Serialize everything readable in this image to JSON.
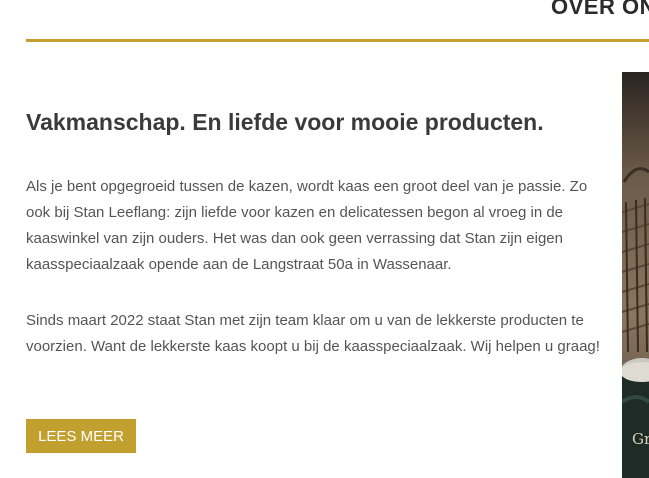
{
  "section": {
    "heading": "OVER ON"
  },
  "main": {
    "headline": "Vakmanschap. En liefde voor mooie producten.",
    "paragraphs": [
      "Als je bent opgegroeid tussen de kazen, wordt kaas een groot deel van je passie. Zo ook bij Stan Leeflang: zijn liefde voor kazen en delicatessen begon al vroeg in de kaaswinkel van zijn ouders. Het was dan ook geen verrassing dat Stan zijn eigen kaasspeciaalzaak opende aan de Langstraat 50a in Wassenaar.",
      "Sinds maart 2022 staat Stan met zijn team klaar om u van de lekkerste producten te voorzien. Want de lekkerste kaas koopt u bij de kaasspeciaalzaak. Wij helpen u graag!"
    ],
    "cta_label": "LEES MEER"
  },
  "image": {
    "visible_text": "Gr"
  },
  "colors": {
    "accent": "#c2a030",
    "heading_text": "#3a3a3a",
    "body_text": "#555555"
  }
}
